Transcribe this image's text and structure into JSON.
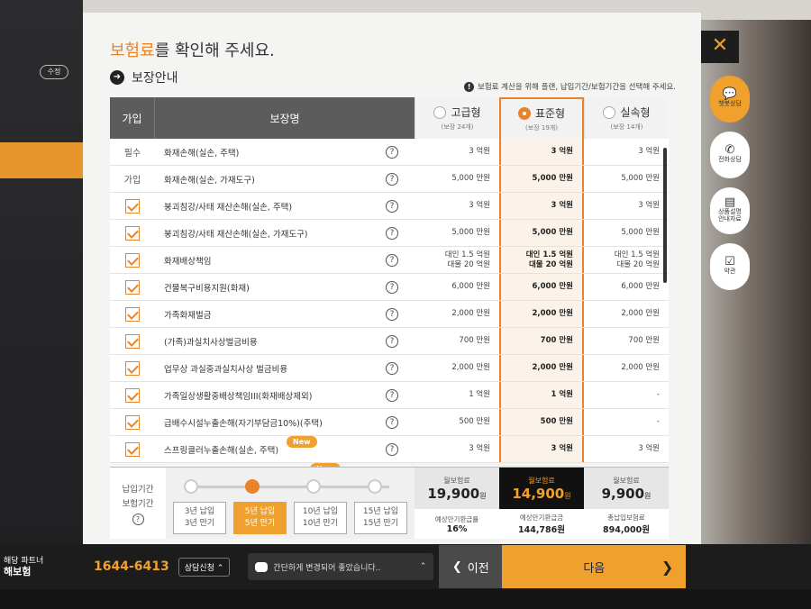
{
  "header": {
    "title_accent": "보험료",
    "title_rest": "를 확인해 주세요.",
    "guide_label": "보장안내",
    "notice": "보험료 계산을 위해 플랜, 납입기간/보험기간을 선택해 주세요."
  },
  "background": {
    "edit_label": "수정"
  },
  "table": {
    "col_join": "가입",
    "col_name": "보장명",
    "plans": [
      {
        "name": "고급형",
        "count": "(보장 24개)",
        "selected": false
      },
      {
        "name": "표준형",
        "count": "(보장 19개)",
        "selected": true
      },
      {
        "name": "실속형",
        "count": "(보장 14개)",
        "selected": false
      }
    ],
    "rows": [
      {
        "join": "필수",
        "name": "화재손해(실손, 주택)",
        "v": [
          "3 억원",
          "3 억원",
          "3 억원"
        ]
      },
      {
        "join": "가입",
        "name": "화재손해(실손, 가재도구)",
        "v": [
          "5,000 만원",
          "5,000 만원",
          "5,000 만원"
        ]
      },
      {
        "join": "check",
        "name": "붕괴침강/사태 재산손해(실손, 주택)",
        "v": [
          "3 억원",
          "3 억원",
          "3 억원"
        ]
      },
      {
        "join": "check",
        "name": "붕괴침강/사태 재산손해(실손, 가재도구)",
        "v": [
          "5,000 만원",
          "5,000 만원",
          "5,000 만원"
        ]
      },
      {
        "join": "check",
        "name": "화재배상책임",
        "v": [
          "대인 1.5 억원\n대물 20 억원",
          "대인 1.5 억원\n대물 20 억원",
          "대인 1.5 억원\n대물 20 억원"
        ]
      },
      {
        "join": "check",
        "name": "건물복구비용지원(화재)",
        "v": [
          "6,000 만원",
          "6,000 만원",
          "6,000 만원"
        ]
      },
      {
        "join": "check",
        "name": "가족화재벌금",
        "v": [
          "2,000 만원",
          "2,000 만원",
          "2,000 만원"
        ]
      },
      {
        "join": "check",
        "name": "(가족)과실치사상벌금비용",
        "v": [
          "700 만원",
          "700 만원",
          "700 만원"
        ]
      },
      {
        "join": "check",
        "name": "업무상 과실중과실치사상 벌금비용",
        "v": [
          "2,000 만원",
          "2,000 만원",
          "2,000 만원"
        ]
      },
      {
        "join": "check",
        "name": "가족일상생활중배상책임III(화재배상제외)",
        "v": [
          "1 억원",
          "1 억원",
          "-"
        ]
      },
      {
        "join": "check",
        "name": "급배수시설누출손해(자기부담금10%)(주택)",
        "v": [
          "500 만원",
          "500 만원",
          "-"
        ]
      },
      {
        "join": "check",
        "name": "스프링클러누출손해(실손, 주택)",
        "v": [
          "3 억원",
          "3 억원",
          "3 억원"
        ]
      }
    ],
    "new_badge": "New"
  },
  "period": {
    "label_line1": "납입기간",
    "label_line2": "보험기간",
    "options": [
      {
        "l1": "3년 납입",
        "l2": "3년 만기",
        "selected": false
      },
      {
        "l1": "5년 납입",
        "l2": "5년 만기",
        "selected": true
      },
      {
        "l1": "10년 납입",
        "l2": "10년 만기",
        "selected": false
      },
      {
        "l1": "15년 납입",
        "l2": "15년 만기",
        "selected": false
      }
    ]
  },
  "premiums": [
    {
      "label": "월보험료",
      "value": "19,900",
      "unit": "원",
      "sub_label": "예상만기환급률",
      "sub_value": "16%"
    },
    {
      "label": "월보험료",
      "value": "14,900",
      "unit": "원",
      "sub_label": "예상만기환급금",
      "sub_value": "144,786원"
    },
    {
      "label": "월보험료",
      "value": "9,900",
      "unit": "원",
      "sub_label": "총납입보험료",
      "sub_value": "894,000원"
    }
  ],
  "side": {
    "close": "✕",
    "chat": "챗봇상담",
    "phone": "전화상담",
    "doc": "상품설명\n안내자료",
    "terms": "약관"
  },
  "footer": {
    "brand_line1": "해당 파트너",
    "brand_line2": "해보험",
    "phone": "1644-6413",
    "consult": "상담신청",
    "message": "간단하게 변경되어 좋았습니다..",
    "prev": "이전",
    "next": "다음"
  },
  "colors": {
    "accent": "#e8832a",
    "dark": "#1d1d1d"
  }
}
